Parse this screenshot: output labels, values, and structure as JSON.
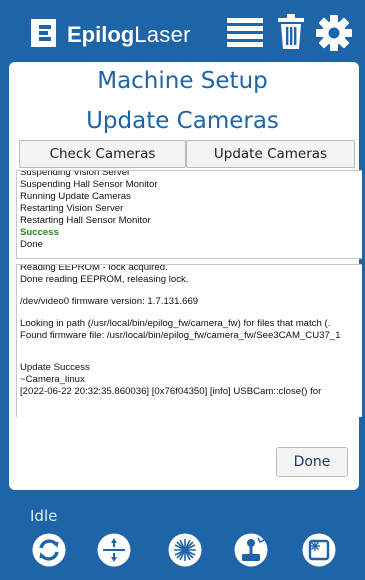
{
  "brand": {
    "name_bold": "Epilog",
    "name_light": "Laser"
  },
  "header": {
    "icons": [
      "menu-icon",
      "trash-icon",
      "gear-icon"
    ]
  },
  "page": {
    "title": "Machine Setup",
    "subtitle": "Update Cameras"
  },
  "actions": {
    "check_label": "Check Cameras",
    "update_label": "Update Cameras",
    "done_label": "Done"
  },
  "log_primary": [
    {
      "text": "Suspending Vision Server",
      "status": "normal"
    },
    {
      "text": "Suspending Hall Sensor Monitor",
      "status": "normal"
    },
    {
      "text": "Running Update Cameras",
      "status": "normal"
    },
    {
      "text": "Restarting Vision Server",
      "status": "normal"
    },
    {
      "text": "Restarting Hall Sensor Monitor",
      "status": "normal"
    },
    {
      "text": "Success",
      "status": "success"
    },
    {
      "text": "Done",
      "status": "normal"
    }
  ],
  "log_detail": [
    "Reading EEPROM - lock acquired.",
    "Done reading EEPROM, releasing lock.",
    "",
    "/dev/video0 firmware version: 1.7.131.669",
    "",
    "Looking in path (/usr/local/bin/epilog_fw/camera_fw) for files that match (.",
    "Found firmware file: /usr/local/bin/epilog_fw/camera_fw/See3CAM_CU37_1",
    "",
    "",
    "Update Success",
    "~Camera_linux",
    "[2022-06-22 20:32:35.860036] [0x76f04350] [info]    USBCam::close() for"
  ],
  "status": {
    "state": "Idle"
  },
  "toolbar": {
    "icons": [
      "refresh-icon",
      "focus-icon",
      "laser-icon",
      "jog-icon",
      "frame-icon"
    ]
  },
  "colors": {
    "brand_blue": "#1d64a8",
    "success_green": "#1f8b1f",
    "panel_white": "#ffffff"
  }
}
